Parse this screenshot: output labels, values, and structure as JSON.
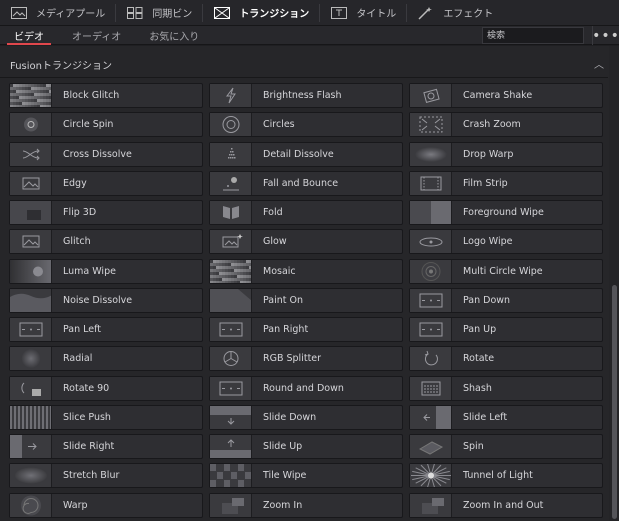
{
  "toolbar": {
    "items": [
      {
        "label": "メディアプール",
        "icon": "media-pool-icon",
        "active": false
      },
      {
        "label": "同期ビン",
        "icon": "sync-bin-icon",
        "active": false
      },
      {
        "label": "トランジション",
        "icon": "transition-icon",
        "active": true
      },
      {
        "label": "タイトル",
        "icon": "title-icon",
        "active": false
      },
      {
        "label": "エフェクト",
        "icon": "effects-icon",
        "active": false
      }
    ]
  },
  "tabs": [
    {
      "label": "ビデオ",
      "active": true
    },
    {
      "label": "オーディオ",
      "active": false
    },
    {
      "label": "お気に入り",
      "active": false
    }
  ],
  "search": {
    "placeholder": "検索"
  },
  "more_label": "•••",
  "section": {
    "title": "Fusionトランジション",
    "collapse_glyph": "︿"
  },
  "transitions": [
    {
      "name": "Block Glitch",
      "thumb": "noise"
    },
    {
      "name": "Brightness Flash",
      "thumb": "bolt"
    },
    {
      "name": "Camera Shake",
      "thumb": "camera"
    },
    {
      "name": "Circle Spin",
      "thumb": "circle-spin"
    },
    {
      "name": "Circles",
      "thumb": "circles"
    },
    {
      "name": "Crash Zoom",
      "thumb": "crash"
    },
    {
      "name": "Cross Dissolve",
      "thumb": "shuffle"
    },
    {
      "name": "Detail Dissolve",
      "thumb": "dots"
    },
    {
      "name": "Drop Warp",
      "thumb": "glow"
    },
    {
      "name": "Edgy",
      "thumb": "image"
    },
    {
      "name": "Fall and Bounce",
      "thumb": "ball"
    },
    {
      "name": "Film Strip",
      "thumb": "film"
    },
    {
      "name": "Flip 3D",
      "thumb": "flip"
    },
    {
      "name": "Fold",
      "thumb": "fold"
    },
    {
      "name": "Foreground Wipe",
      "thumb": "split"
    },
    {
      "name": "Glitch",
      "thumb": "image"
    },
    {
      "name": "Glow",
      "thumb": "image-star"
    },
    {
      "name": "Logo Wipe",
      "thumb": "eye"
    },
    {
      "name": "Luma Wipe",
      "thumb": "luma"
    },
    {
      "name": "Mosaic",
      "thumb": "noise"
    },
    {
      "name": "Multi Circle Wipe",
      "thumb": "target"
    },
    {
      "name": "Noise Dissolve",
      "thumb": "wave"
    },
    {
      "name": "Paint On",
      "thumb": "paint"
    },
    {
      "name": "Pan Down",
      "thumb": "frame"
    },
    {
      "name": "Pan Left",
      "thumb": "frame"
    },
    {
      "name": "Pan Right",
      "thumb": "frame"
    },
    {
      "name": "Pan Up",
      "thumb": "frame"
    },
    {
      "name": "Radial",
      "thumb": "radial"
    },
    {
      "name": "RGB Splitter",
      "thumb": "rgb"
    },
    {
      "name": "Rotate",
      "thumb": "rotate"
    },
    {
      "name": "Rotate 90",
      "thumb": "rotate90"
    },
    {
      "name": "Round and Down",
      "thumb": "frame"
    },
    {
      "name": "Shash",
      "thumb": "shash"
    },
    {
      "name": "Slice Push",
      "thumb": "stripes"
    },
    {
      "name": "Slide Down",
      "thumb": "slide-down"
    },
    {
      "name": "Slide Left",
      "thumb": "slide-left"
    },
    {
      "name": "Slide Right",
      "thumb": "slide-right"
    },
    {
      "name": "Slide Up",
      "thumb": "slide-up"
    },
    {
      "name": "Spin",
      "thumb": "spin"
    },
    {
      "name": "Stretch Blur",
      "thumb": "blur"
    },
    {
      "name": "Tile Wipe",
      "thumb": "tiles"
    },
    {
      "name": "Tunnel of Light",
      "thumb": "burst"
    },
    {
      "name": "Warp",
      "thumb": "swirl"
    },
    {
      "name": "Zoom In",
      "thumb": "zoom"
    },
    {
      "name": "Zoom In and Out",
      "thumb": "zoom"
    }
  ],
  "colors": {
    "accent_tab_underline": "#e0474c"
  }
}
